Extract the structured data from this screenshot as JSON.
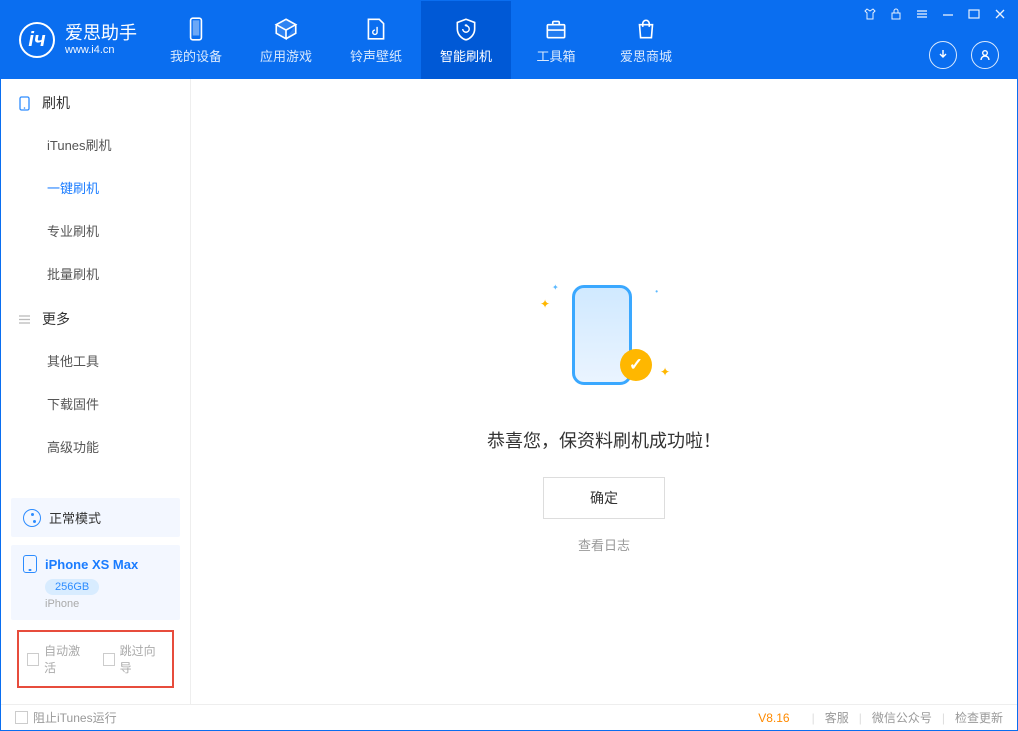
{
  "app": {
    "title": "爱思助手",
    "subtitle": "www.i4.cn"
  },
  "nav": {
    "device": "我的设备",
    "apps": "应用游戏",
    "ring": "铃声壁纸",
    "flash": "智能刷机",
    "tools": "工具箱",
    "store": "爱思商城"
  },
  "sidebar": {
    "group1": {
      "title": "刷机",
      "items": [
        "iTunes刷机",
        "一键刷机",
        "专业刷机",
        "批量刷机"
      ]
    },
    "group2": {
      "title": "更多",
      "items": [
        "其他工具",
        "下载固件",
        "高级功能"
      ]
    },
    "mode": "正常模式",
    "device": {
      "name": "iPhone XS Max",
      "storage": "256GB",
      "type": "iPhone"
    },
    "opt_auto": "自动激活",
    "opt_skip": "跳过向导"
  },
  "main": {
    "success": "恭喜您，保资料刷机成功啦！",
    "confirm": "确定",
    "view_log": "查看日志"
  },
  "footer": {
    "block_itunes": "阻止iTunes运行",
    "version": "V8.16",
    "support": "客服",
    "wechat": "微信公众号",
    "update": "检查更新"
  }
}
